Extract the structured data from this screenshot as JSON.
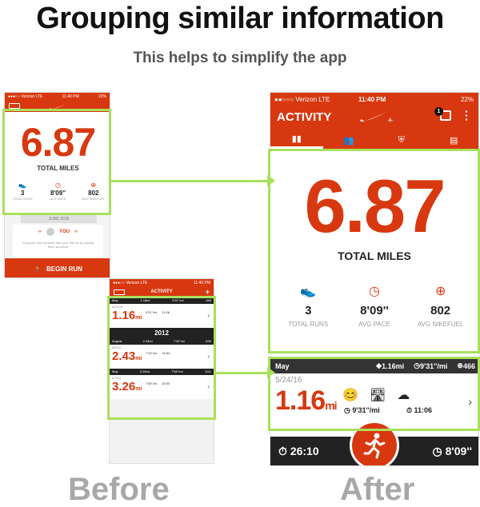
{
  "heading": {
    "title": "Grouping similar information",
    "subtitle": "This helps to simplify the app"
  },
  "captions": {
    "before": "Before",
    "after": "After"
  },
  "colors": {
    "brand": "#d8380f",
    "highlight": "#a8e05c",
    "dark_bar": "#222222"
  },
  "before_screen_1": {
    "status_carrier": "●●●○○ Verizon  LTE",
    "status_time": "11:40 PM",
    "status_battery": "22%",
    "distance": "6.87",
    "total_label": "TOTAL MILES",
    "stats": [
      {
        "icon": "shoe-icon",
        "value": "3",
        "label": "TOTAL RUNS"
      },
      {
        "icon": "clock-icon",
        "value": "8'09''",
        "label": "AVG PACE"
      },
      {
        "icon": "fuel-icon",
        "value": "802",
        "label": "AVG NIKEFUEL"
      }
    ],
    "month_divider": "JUNE 2016",
    "you_label": "YOU",
    "compare_text": "Compare and compete with your friends by adding them as follow",
    "begin_run_label": "BEGIN RUN"
  },
  "before_screen_2": {
    "status_carrier": "●●●○○ Verizon  LTE",
    "status_time": "11:40 PM",
    "title": "ACTIVITY",
    "year_divider": "2012",
    "entries": [
      {
        "month": "May",
        "distance_total": "1.16mi",
        "pace_total": "9'31''/mi",
        "fuel_total": "466",
        "date": "5/24/16",
        "distance": "1.16",
        "unit": "mi",
        "pace": "9'31''/mi",
        "duration": "11:06"
      },
      {
        "month": "August",
        "distance_total": "2.43mi",
        "pace_total": "7'40''/mi",
        "fuel_total": "830",
        "date": "8/8/12",
        "distance": "2.43",
        "unit": "mi",
        "pace": "7'43''/mi",
        "duration": "18:54"
      },
      {
        "month": "May",
        "distance_total": "3.26mi",
        "pace_total": "7'58''/mi",
        "fuel_total": "1111",
        "date": "5/7/12",
        "distance": "3.26",
        "unit": "mi",
        "pace": "7'58''/mi",
        "duration": "26:00"
      }
    ]
  },
  "after_screen": {
    "status_carrier": "●●○○○ Verizon  LTE",
    "status_time": "11:40 PM",
    "status_battery": "22%",
    "title": "ACTIVITY",
    "notification_count": "1",
    "tabs": [
      {
        "icon": "bar-chart-icon",
        "active": true
      },
      {
        "icon": "friends-icon",
        "active": false
      },
      {
        "icon": "shield-icon",
        "active": false
      },
      {
        "icon": "clipboard-icon",
        "active": false
      }
    ],
    "distance": "6.87",
    "total_label": "TOTAL MILES",
    "stats": [
      {
        "icon": "shoe-icon",
        "value": "3",
        "label": "TOTAL RUNS"
      },
      {
        "icon": "clock-icon",
        "value": "8'09''",
        "label": "AVG PACE"
      },
      {
        "icon": "fuel-icon",
        "value": "802",
        "label": "AVG NIKEFUEL"
      }
    ],
    "month_bar": {
      "month": "May",
      "distance": "1.16mi",
      "pace": "9'31''/mi",
      "fuel": "466"
    },
    "run": {
      "date": "5/24/16",
      "distance": "1.16",
      "unit": "mi",
      "pace": "9'31''/mi",
      "duration": "11:06"
    },
    "footer": {
      "timer": "26:10",
      "pace": "8'09''"
    }
  }
}
